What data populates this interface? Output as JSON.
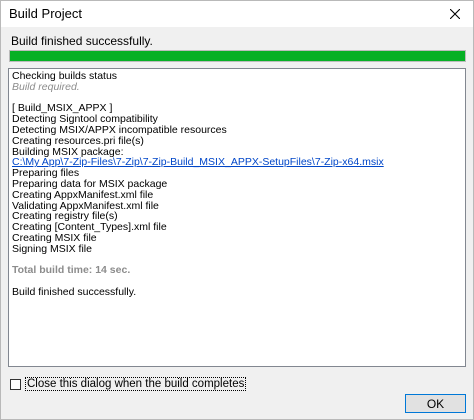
{
  "window": {
    "title": "Build Project"
  },
  "status": {
    "message": "Build finished successfully.",
    "progress_percent": 100,
    "progress_color": "#06b025"
  },
  "log": {
    "lines": [
      {
        "text": "Checking builds status",
        "style": "normal"
      },
      {
        "text": "Build required.",
        "style": "muted"
      },
      {
        "text": "",
        "style": "blank"
      },
      {
        "text": "[ Build_MSIX_APPX ]",
        "style": "normal"
      },
      {
        "text": "Detecting Signtool compatibility",
        "style": "normal"
      },
      {
        "text": "Detecting MSIX/APPX incompatible resources",
        "style": "normal"
      },
      {
        "text": "Creating resources.pri file(s)",
        "style": "normal"
      },
      {
        "text": "Building MSIX package:",
        "style": "normal"
      },
      {
        "text": "C:\\My App\\7-Zip-Files\\7-Zip\\7-Zip-Build_MSIX_APPX-SetupFiles\\7-Zip-x64.msix",
        "style": "link"
      },
      {
        "text": "Preparing files",
        "style": "normal"
      },
      {
        "text": "Preparing data for MSIX package",
        "style": "normal"
      },
      {
        "text": "Creating AppxManifest.xml file",
        "style": "normal"
      },
      {
        "text": "Validating AppxManifest.xml file",
        "style": "normal"
      },
      {
        "text": "Creating registry file(s)",
        "style": "normal"
      },
      {
        "text": "Creating [Content_Types].xml file",
        "style": "normal"
      },
      {
        "text": "Creating MSIX file",
        "style": "normal"
      },
      {
        "text": "Signing MSIX file",
        "style": "normal"
      },
      {
        "text": "",
        "style": "blank"
      },
      {
        "text": "Total build time: 14 sec.",
        "style": "bold-muted"
      },
      {
        "text": "",
        "style": "blank"
      },
      {
        "text": "Build finished successfully.",
        "style": "normal"
      }
    ]
  },
  "footer": {
    "close_checkbox_label": "Close this dialog when the build completes",
    "close_checkbox_checked": false,
    "ok_label": "OK"
  },
  "icons": {
    "close": "close-icon"
  }
}
